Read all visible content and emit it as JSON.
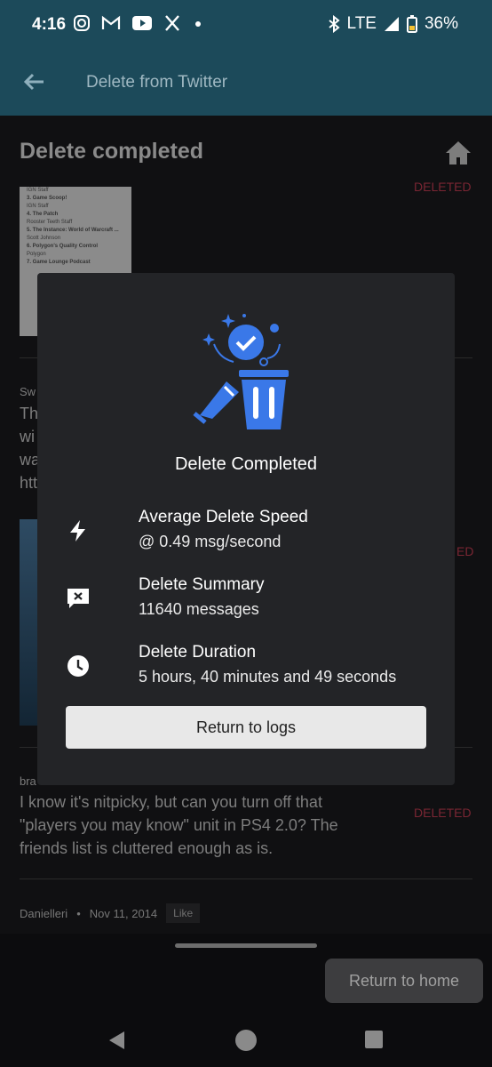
{
  "status": {
    "time": "4:16",
    "network": "LTE",
    "battery": "36%"
  },
  "app_bar": {
    "title": "Delete from Twitter"
  },
  "page": {
    "heading": "Delete completed"
  },
  "background": {
    "thumb_lines": [
      "IGN Staff",
      "3. Game Scoop!",
      "IGN Staff",
      "4. The Patch",
      "Rooster Teeth Staff",
      "5. The Instance: World of Warcraft ...",
      "Scott Johnson",
      "6. Polygon's Quality Control",
      "Polygon",
      "7. Game Lounge Podcast",
      "8.",
      "9.",
      "10."
    ],
    "deleted_label": "DELETED",
    "tweet1_author": "Sw",
    "tweet1_lines": [
      "Th",
      "wi",
      "wa",
      "htt"
    ],
    "tweet2_author": "bra",
    "tweet2_text": "I know it's nitpicky, but can you turn off that \"players you may know\" unit in PS4 2.0? The friends list is cluttered enough as is.",
    "tweet3_author": "Danielleri",
    "tweet3_date": "Nov 11, 2014",
    "tweet3_like": "Like"
  },
  "modal": {
    "title": "Delete Completed",
    "stats": [
      {
        "icon": "lightning-icon",
        "label": "Average Delete Speed",
        "value": "@ 0.49 msg/second"
      },
      {
        "icon": "message-x-icon",
        "label": "Delete Summary",
        "value": "11640 messages"
      },
      {
        "icon": "clock-icon",
        "label": "Delete Duration",
        "value": "5 hours, 40 minutes and 49 seconds"
      }
    ],
    "return_logs_label": "Return to logs"
  },
  "bottom": {
    "return_home_label": "Return to home"
  },
  "colors": {
    "app_bar": "#1c4a5a",
    "modal_bg": "#232427",
    "accent_blue": "#2f6fe0",
    "deleted_red": "#7a2633"
  }
}
